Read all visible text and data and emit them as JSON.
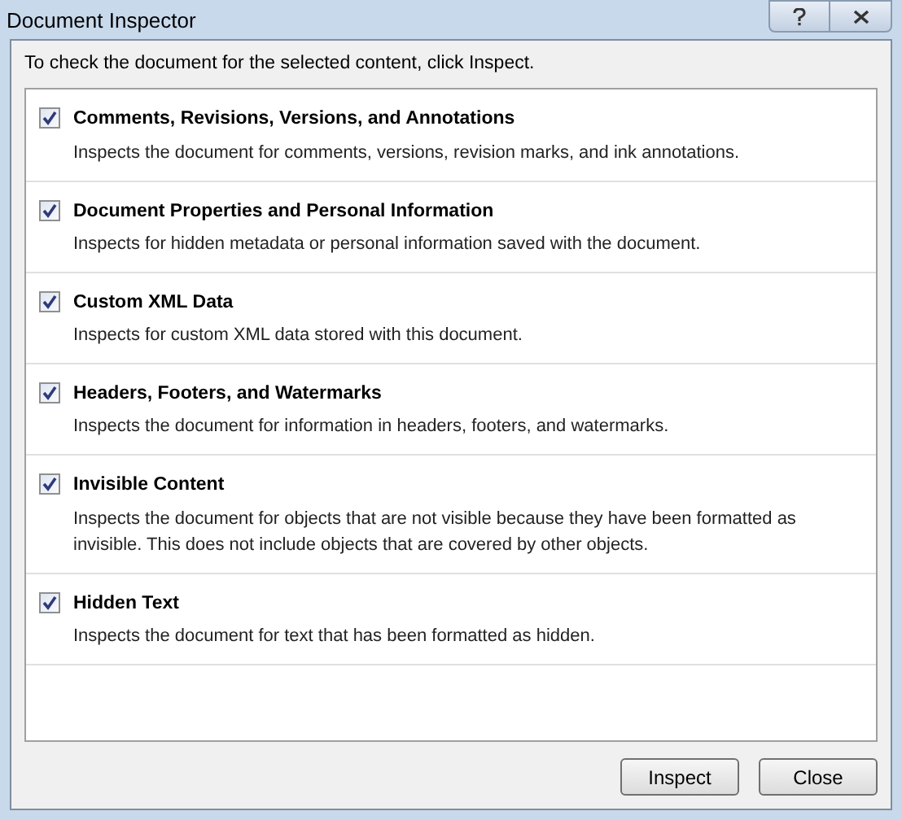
{
  "window": {
    "title": "Document Inspector"
  },
  "instruction": "To check the document for the selected content, click Inspect.",
  "items": [
    {
      "title": "Comments, Revisions, Versions, and Annotations",
      "description": "Inspects the document for comments, versions, revision marks, and ink annotations.",
      "checked": true
    },
    {
      "title": "Document Properties and Personal Information",
      "description": "Inspects for hidden metadata or personal information saved with the document.",
      "checked": true
    },
    {
      "title": "Custom XML Data",
      "description": "Inspects for custom XML data stored with this document.",
      "checked": true
    },
    {
      "title": "Headers, Footers, and Watermarks",
      "description": "Inspects the document for information in headers, footers, and watermarks.",
      "checked": true
    },
    {
      "title": "Invisible Content",
      "description": "Inspects the document for objects that are not visible because they have been formatted as invisible. This does not include objects that are covered by other objects.",
      "checked": true
    },
    {
      "title": "Hidden Text",
      "description": "Inspects the document for text that has been formatted as hidden.",
      "checked": true
    }
  ],
  "buttons": [
    "Inspect",
    "Close"
  ]
}
